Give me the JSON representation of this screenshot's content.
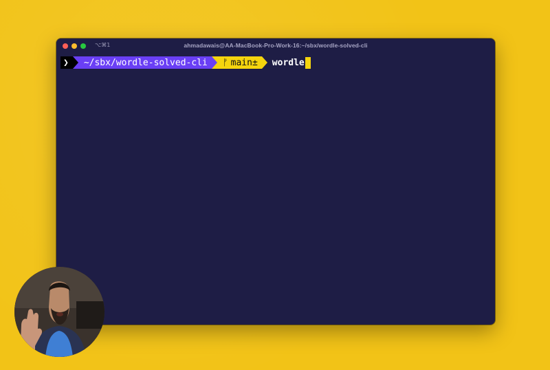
{
  "window": {
    "title": "ahmadawais@AA-MacBook-Pro-Work-16:~/sbx/wordle-solved-cli",
    "shortcut": "⌥⌘1"
  },
  "prompt": {
    "arrow": "❯",
    "path": "~/sbx/wordle-solved-cli",
    "git_icon": "ᚠ",
    "branch": "main±",
    "command": "wordle"
  },
  "colors": {
    "background": "#f2c317",
    "terminal_bg": "#1e1d45",
    "path_segment": "#6a3ff5",
    "git_segment": "#f5d40e",
    "cursor": "#f5d40e"
  }
}
